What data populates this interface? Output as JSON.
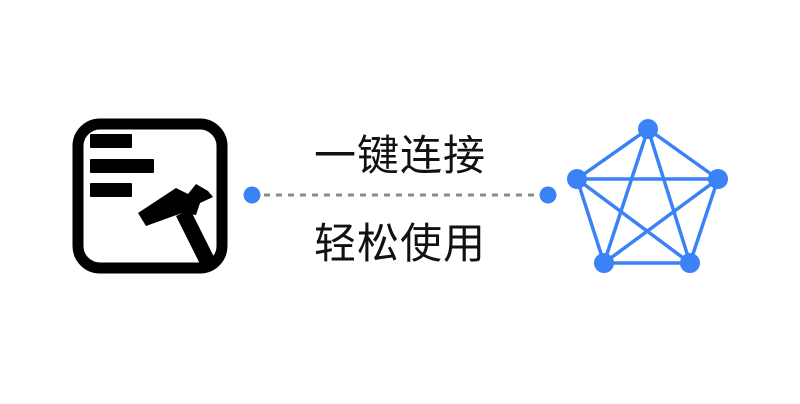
{
  "captions": {
    "top": "一键连接",
    "bottom": "轻松使用"
  },
  "icons": {
    "left": "toolbox-hammer-icon",
    "right": "pentagon-network-icon"
  },
  "colors": {
    "accent": "#3b82f6",
    "ink": "#000000",
    "connector": "#8a8a8a",
    "background": "#ffffff"
  }
}
